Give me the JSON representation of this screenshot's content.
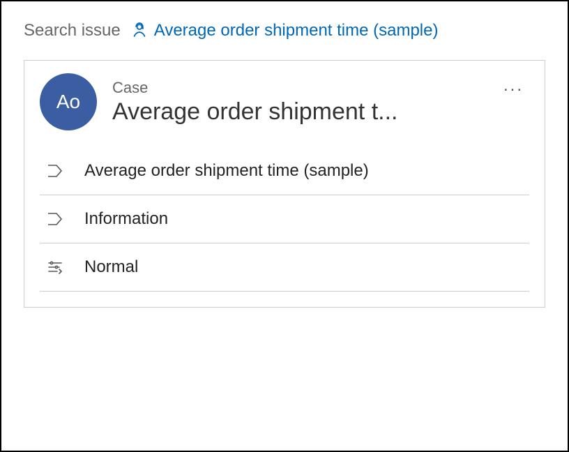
{
  "breadcrumb": {
    "prev": "Search issue",
    "current": "Average order shipment time (sample)"
  },
  "card": {
    "avatar_initials": "Ao",
    "entity_label": "Case",
    "title": "Average order shipment t...",
    "rows": {
      "title_full": "Average order shipment time (sample)",
      "info": "Information",
      "priority": "Normal"
    }
  }
}
